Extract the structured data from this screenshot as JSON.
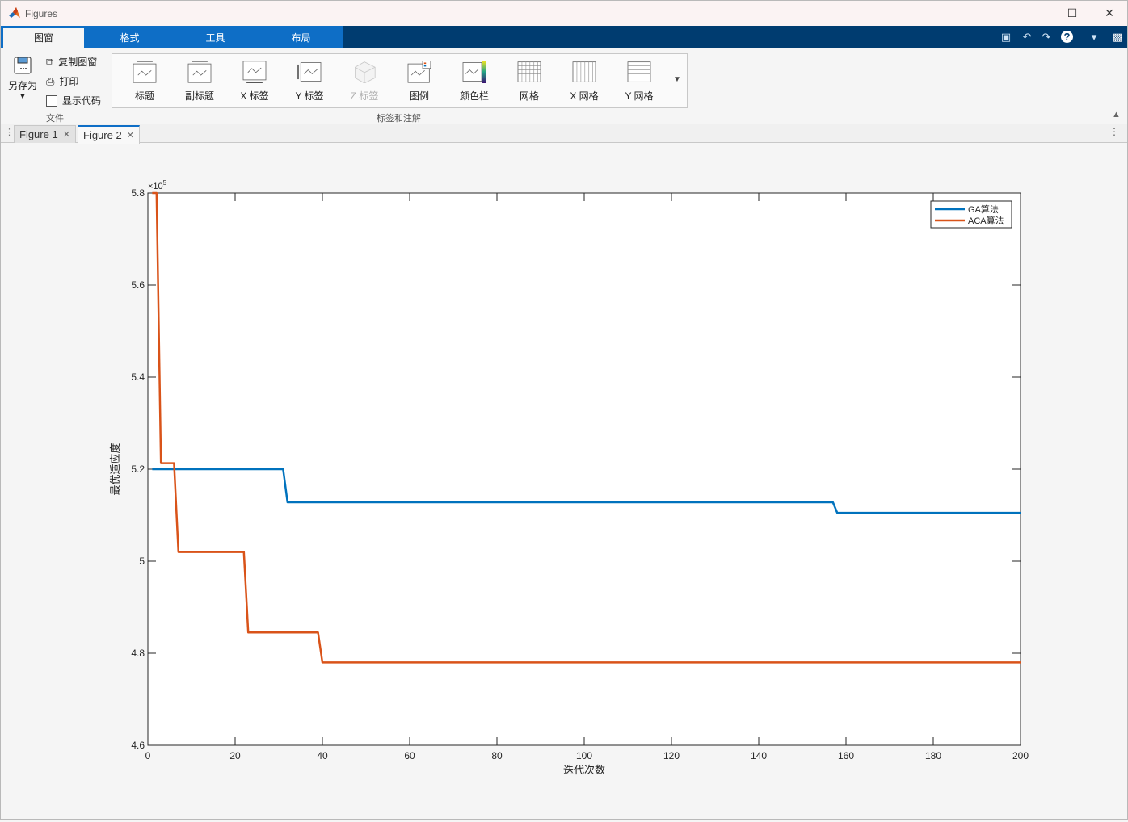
{
  "window": {
    "title": "Figures"
  },
  "ribbon_tabs": [
    "图窗",
    "格式",
    "工具",
    "布局"
  ],
  "file_group": {
    "save_as": "另存为",
    "copy_figure": "复制图窗",
    "print": "打印",
    "show_code": "显示代码",
    "label": "文件"
  },
  "annotate_group": {
    "label": "标签和注解",
    "items": [
      {
        "label": "标题",
        "icon": "title-icon",
        "enabled": true
      },
      {
        "label": "副标题",
        "icon": "subtitle-icon",
        "enabled": true
      },
      {
        "label": "X 标签",
        "icon": "xlabel-icon",
        "enabled": true
      },
      {
        "label": "Y 标签",
        "icon": "ylabel-icon",
        "enabled": true
      },
      {
        "label": "Z 标签",
        "icon": "zlabel-icon",
        "enabled": false
      },
      {
        "label": "图例",
        "icon": "legend-icon",
        "enabled": true
      },
      {
        "label": "颜色栏",
        "icon": "colorbar-icon",
        "enabled": true
      },
      {
        "label": "网格",
        "icon": "grid-icon",
        "enabled": true
      },
      {
        "label": "X 网格",
        "icon": "xgrid-icon",
        "enabled": true
      },
      {
        "label": "Y 网格",
        "icon": "ygrid-icon",
        "enabled": true
      }
    ]
  },
  "doc_tabs": [
    {
      "label": "Figure 1",
      "active": false
    },
    {
      "label": "Figure 2",
      "active": true
    }
  ],
  "colors": {
    "accent": "#0e6ec6",
    "tabbar": "#003c70",
    "ga": "#0072bd",
    "aca": "#d95319"
  },
  "chart_data": {
    "type": "line",
    "title": "",
    "xlabel": "迭代次数",
    "ylabel": "最优适应度",
    "exponent_label": "×10",
    "exponent_power": "5",
    "xlim": [
      0,
      200
    ],
    "ylim": [
      4.6,
      5.8
    ],
    "xticks": [
      "0",
      "20",
      "40",
      "60",
      "80",
      "100",
      "120",
      "140",
      "160",
      "180",
      "200"
    ],
    "yticks": [
      "4.6",
      "4.8",
      "5",
      "5.2",
      "5.4",
      "5.6",
      "5.8"
    ],
    "grid": false,
    "legend_position": "top-right",
    "series": [
      {
        "name": "GA算法",
        "color": "#0072bd",
        "x": [
          1,
          31,
          32,
          157,
          158,
          200
        ],
        "y": [
          5.2,
          5.2,
          5.128,
          5.128,
          5.105,
          5.105
        ]
      },
      {
        "name": "ACA算法",
        "color": "#d95319",
        "x": [
          1,
          2,
          3,
          6,
          7,
          22,
          23,
          39,
          40,
          200
        ],
        "y": [
          5.8,
          5.8,
          5.213,
          5.213,
          5.02,
          5.02,
          4.845,
          4.845,
          4.78,
          4.78
        ]
      }
    ]
  }
}
